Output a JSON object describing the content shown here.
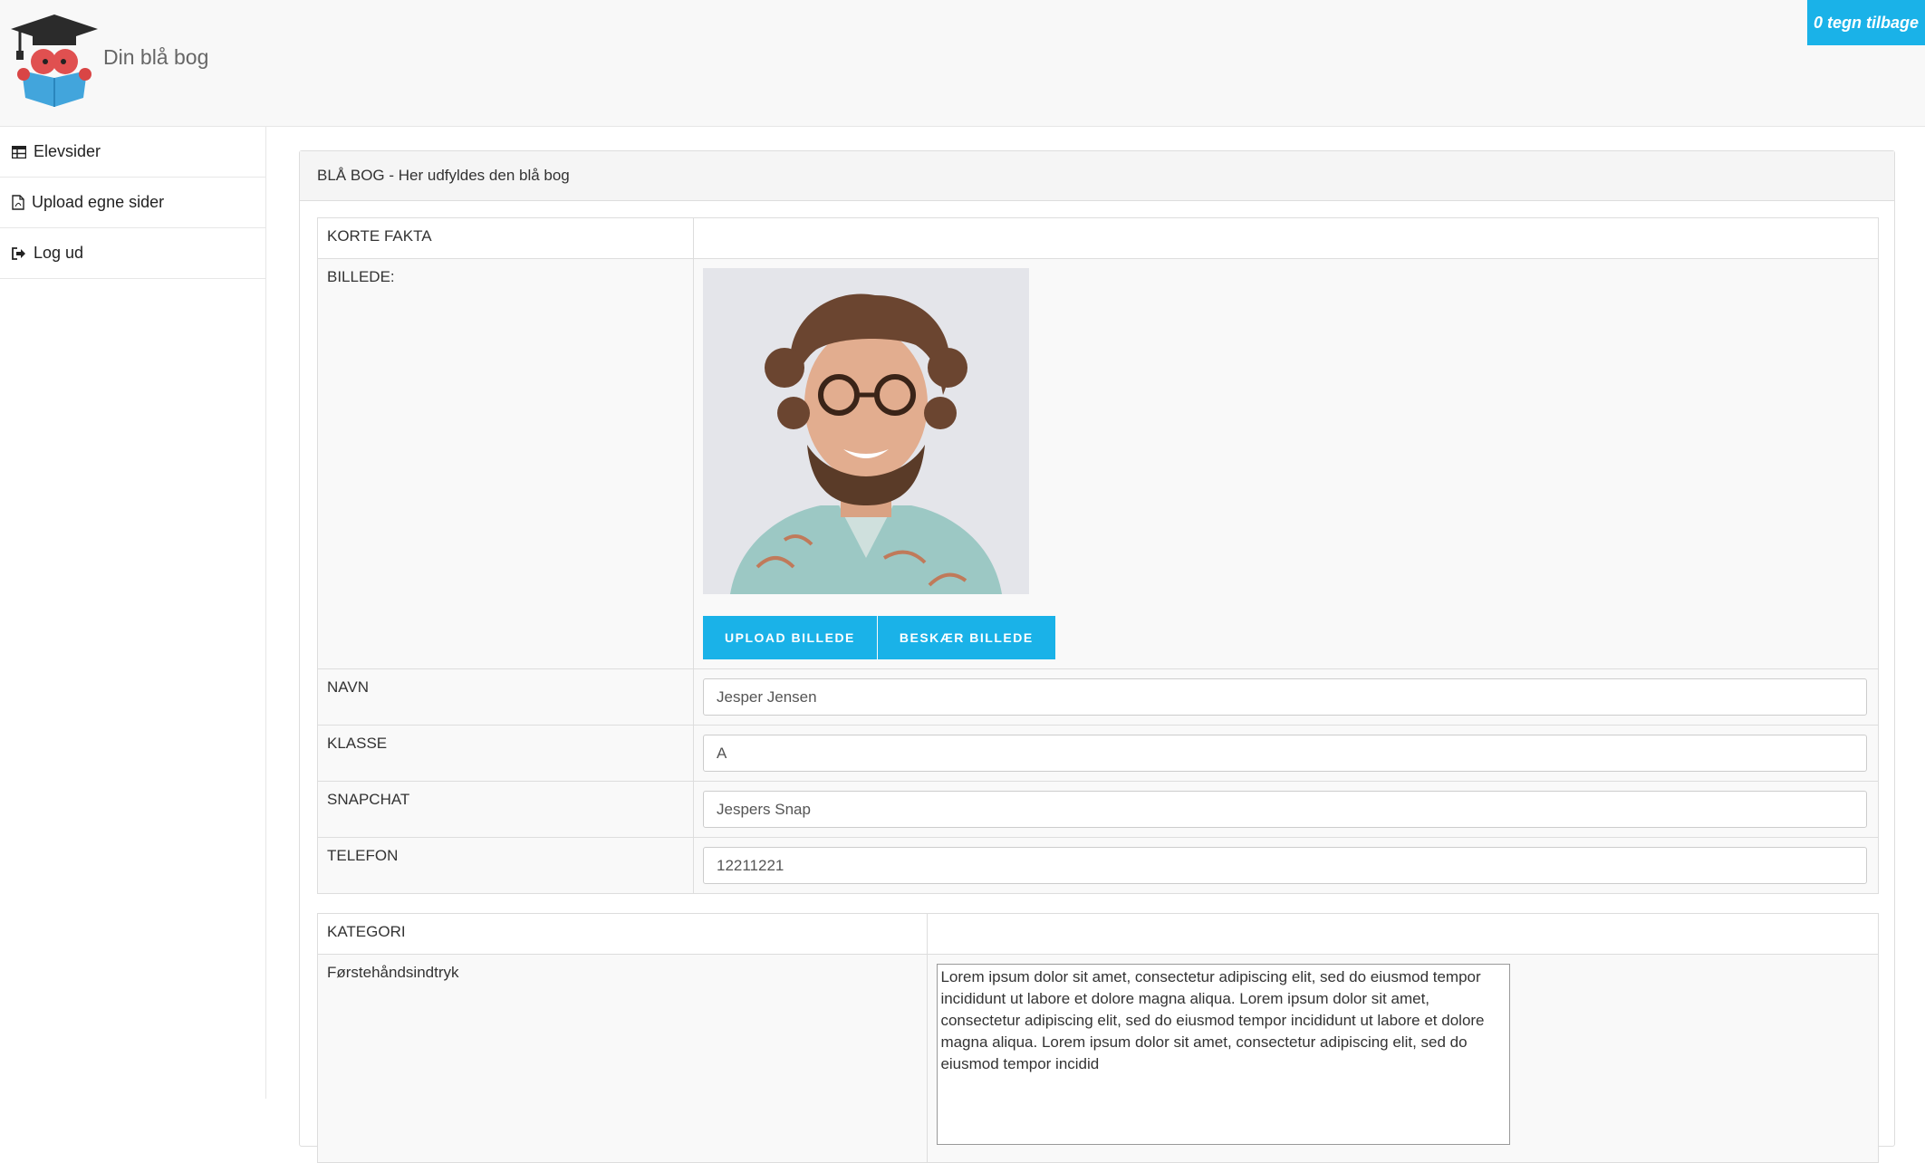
{
  "app": {
    "brand": "Din blå bog",
    "counter": "0 tegn tilbage"
  },
  "sidebar": {
    "items": [
      {
        "label": "Elevsider",
        "icon": "table-icon"
      },
      {
        "label": "Upload egne sider",
        "icon": "pdf-file-icon"
      },
      {
        "label": "Log ud",
        "icon": "sign-out-icon"
      }
    ]
  },
  "panel": {
    "title": "BLÅ BOG - Her udfyldes den blå bog",
    "facts": {
      "header": "KORTE FAKTA",
      "picture_label": "BILLEDE:",
      "upload_button": "UPLOAD BILLEDE",
      "crop_button": "BESKÆR BILLEDE",
      "fields": [
        {
          "label": "NAVN",
          "value": "Jesper Jensen"
        },
        {
          "label": "KLASSE",
          "value": "A"
        },
        {
          "label": "SNAPCHAT",
          "value": "Jespers Snap"
        },
        {
          "label": "TELEFON",
          "value": "12211221"
        }
      ]
    },
    "category": {
      "header": "KATEGORI",
      "label": "Førstehåndsindtryk",
      "text": "Lorem ipsum dolor sit amet, consectetur adipiscing elit, sed do eiusmod tempor incididunt ut labore et dolore magna aliqua. Lorem ipsum dolor sit amet, consectetur adipiscing elit, sed do eiusmod tempor incididunt ut labore et dolore magna aliqua. Lorem ipsum dolor sit amet, consectetur adipiscing elit, sed do eiusmod tempor incidid"
    }
  },
  "colors": {
    "accent": "#1ab2e8",
    "header_bg": "#f8f8f8",
    "border": "#dddddd"
  }
}
